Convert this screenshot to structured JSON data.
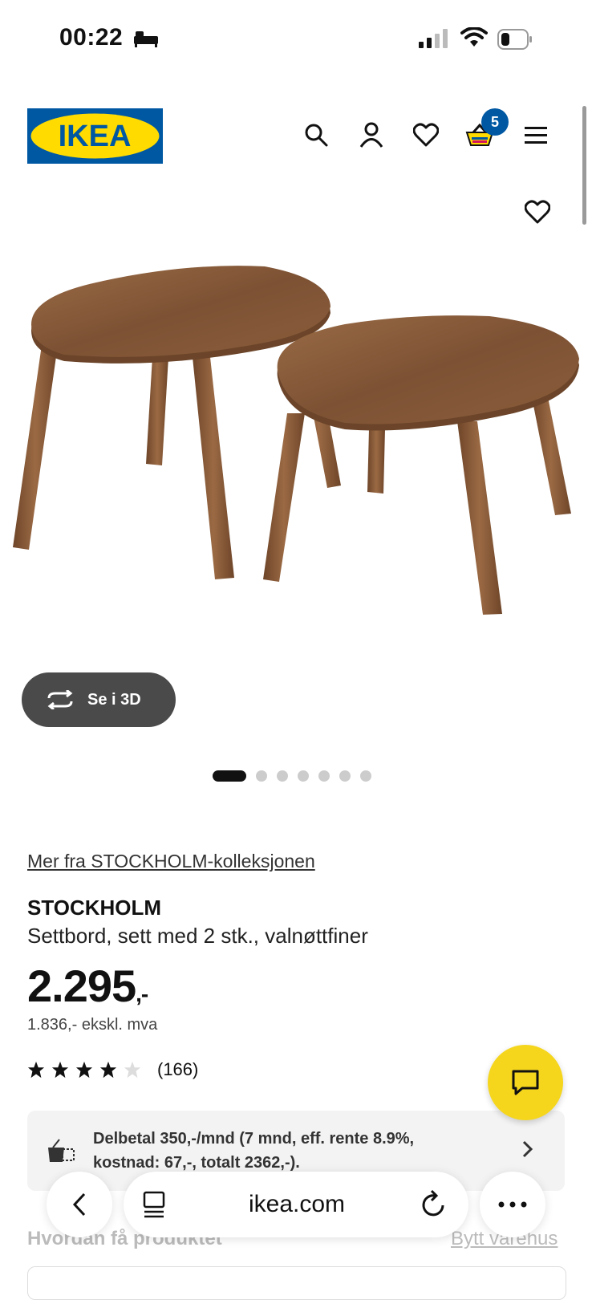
{
  "status_bar": {
    "time": "00:22"
  },
  "header": {
    "logo_text": "IKEA",
    "cart_count": "5",
    "icons": [
      "search-icon",
      "account-icon",
      "heart-icon",
      "basket-icon",
      "hamburger-menu-icon"
    ]
  },
  "gallery": {
    "view_3d_label": "Se i 3D",
    "dots_total": 7,
    "active_dot": 1
  },
  "product": {
    "collection_link": "Mer fra STOCKHOLM-kolleksjonen",
    "name": "STOCKHOLM",
    "description": "Settbord, sett med 2 stk., valnøttfiner",
    "price": "2.295",
    "price_suffix": ",-",
    "price_ex_vat": "1.836,- ekskl. mva",
    "rating": 4,
    "rating_max": 5,
    "review_count": "(166)"
  },
  "finance": {
    "text": "Delbetal 350,-/mnd (7 mnd, eff. rente 8.9%, kostnad: 67,-, totalt 2362,-)."
  },
  "delivery": {
    "heading": "Hvordan få produktet",
    "change_store": "Bytt varehus"
  },
  "browser": {
    "url": "ikea.com"
  },
  "colors": {
    "ikea_blue": "#0058a3",
    "ikea_yellow": "#ffdb00",
    "chat_yellow": "#f5d61d"
  }
}
